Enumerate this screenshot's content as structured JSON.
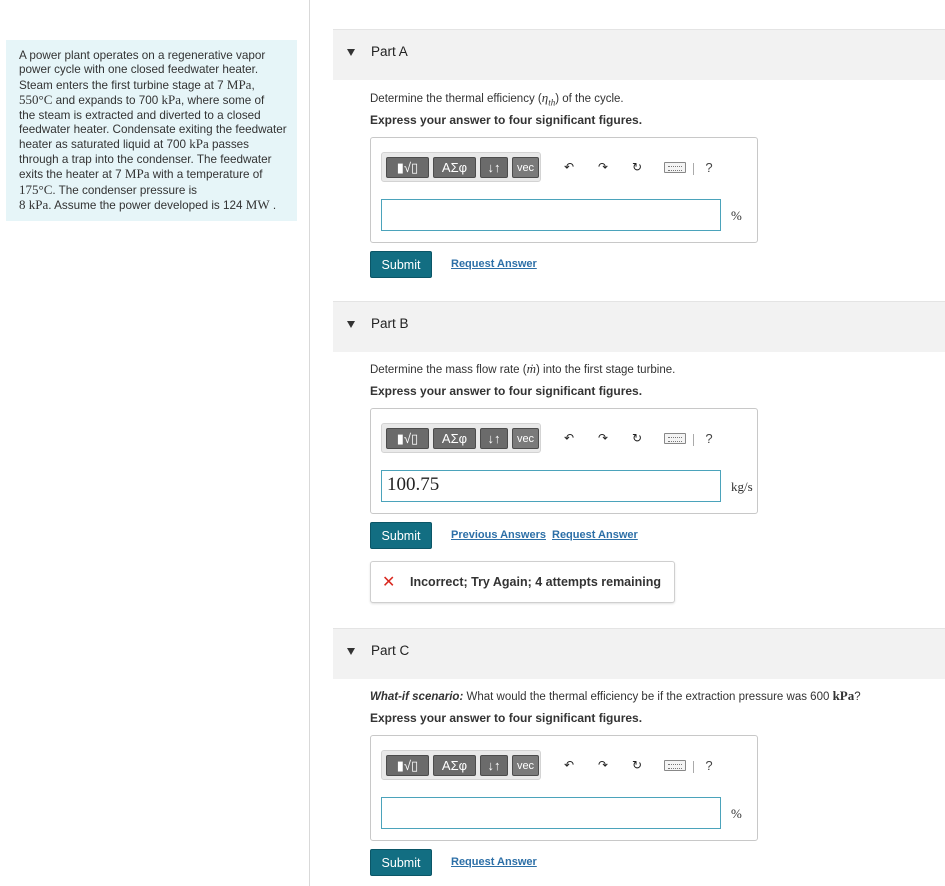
{
  "problem": {
    "lines": [
      [
        "A power plant operates on a regenerative vapor"
      ],
      [
        "power cycle with one closed feedwater heater."
      ],
      [
        "Steam enters the first turbine stage at 7 ",
        {
          "m": "MPa"
        },
        ","
      ],
      [
        {
          "m": "550°C"
        },
        " and expands to 700 ",
        {
          "m": "kPa"
        },
        ", where some of"
      ],
      [
        "the steam is extracted and diverted to a closed"
      ],
      [
        "feedwater heater. Condensate exiting the feedwater"
      ],
      [
        "heater as saturated liquid at 700 ",
        {
          "m": "kPa"
        },
        " passes"
      ],
      [
        "through a trap into the condenser. The feedwater"
      ],
      [
        "exits the heater at 7 ",
        {
          "m": "MPa"
        },
        " with a temperature of"
      ],
      [
        {
          "m": "175°C"
        },
        ". The condenser pressure is"
      ],
      [
        {
          "m": "8 kPa"
        },
        ". Assume the power developed is 124 ",
        {
          "m": "MW"
        },
        " ."
      ]
    ]
  },
  "toolbar": {
    "templates_glyph": "▮√▯",
    "greek_label": "ΑΣφ",
    "arrows_label": "↓↑",
    "vec_label": "vec",
    "undo_glyph": "↶",
    "redo_glyph": "↷",
    "reset_glyph": "↻",
    "help_label": "?"
  },
  "parts": {
    "a": {
      "title": "Part A",
      "question": [
        [
          "Determine the thermal efficiency ("
        ],
        [
          {
            "m": "η"
          }
        ],
        [
          {
            "sub": "th"
          }
        ],
        [
          ") of the cycle."
        ]
      ],
      "instruction": "Express your answer to four significant figures.",
      "input_value": "",
      "unit": "%",
      "submit_label": "Submit",
      "request_label": "Request Answer"
    },
    "b": {
      "title": "Part B",
      "question_pre": "Determine the mass flow rate (",
      "question_sym": "ṁ",
      "question_post": ") into the first stage turbine.",
      "instruction": "Express your answer to four significant figures.",
      "input_value": "100.75",
      "unit": "kg/s",
      "submit_label": "Submit",
      "previous_label": "Previous Answers",
      "request_label": "Request Answer",
      "feedback": "Incorrect; Try Again; 4 attempts remaining"
    },
    "c": {
      "title": "Part C",
      "question_lead": "What-if scenario:",
      "question_body": " What would the thermal efficiency be if the extraction pressure was 600 ",
      "question_unit": "kPa",
      "question_end": "?",
      "instruction": "Express your answer to four significant figures.",
      "input_value": "",
      "unit": "%",
      "submit_label": "Submit",
      "request_label": "Request Answer"
    }
  },
  "colors": {
    "problem_bg": "#e6f5f8",
    "submit_bg": "#126e82",
    "link": "#2c6fa7",
    "input_border": "#4ba3bb",
    "error": "#d9281f"
  }
}
